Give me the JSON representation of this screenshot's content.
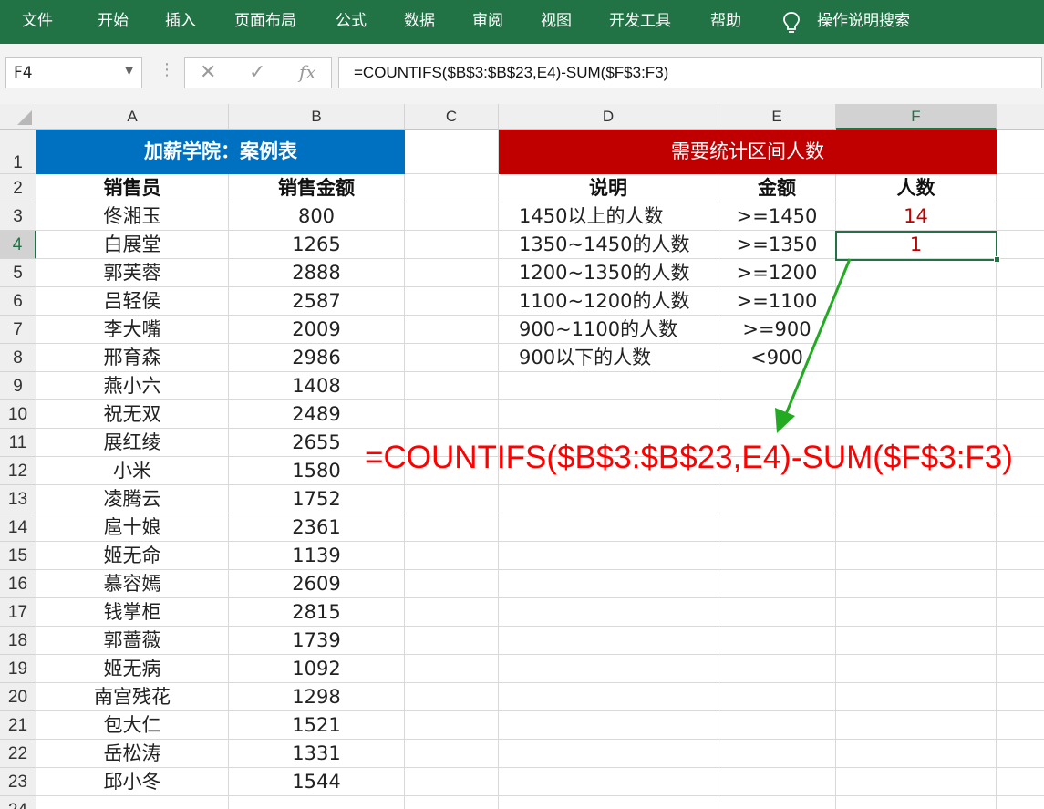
{
  "ribbon": {
    "tabs": [
      "文件",
      "开始",
      "插入",
      "页面布局",
      "公式",
      "数据",
      "审阅",
      "视图",
      "开发工具",
      "帮助"
    ],
    "search_label": "操作说明搜索"
  },
  "formula_bar": {
    "name_box": "F4",
    "fx_label": "fx",
    "cancel_icon": "✕",
    "enter_icon": "✓",
    "formula": "=COUNTIFS($B$3:$B$23,E4)-SUM($F$3:F3)"
  },
  "grid": {
    "columns": [
      "A",
      "B",
      "C",
      "D",
      "E",
      "F"
    ],
    "selected_cell": "F4",
    "row_numbers": [
      "1",
      "2",
      "3",
      "4",
      "5",
      "6",
      "7",
      "8",
      "9",
      "10",
      "11",
      "12",
      "13",
      "14",
      "15",
      "16",
      "17",
      "18",
      "19",
      "20",
      "21",
      "22",
      "23",
      "24"
    ]
  },
  "sales_table": {
    "title": "加薪学院：案例表",
    "headers": [
      "销售员",
      "销售金额"
    ],
    "rows": [
      [
        "佟湘玉",
        "800"
      ],
      [
        "白展堂",
        "1265"
      ],
      [
        "郭芙蓉",
        "2888"
      ],
      [
        "吕轻侯",
        "2587"
      ],
      [
        "李大嘴",
        "2009"
      ],
      [
        "邢育森",
        "2986"
      ],
      [
        "燕小六",
        "1408"
      ],
      [
        "祝无双",
        "2489"
      ],
      [
        "展红绫",
        "2655"
      ],
      [
        "小米",
        "1580"
      ],
      [
        "凌腾云",
        "1752"
      ],
      [
        "扈十娘",
        "2361"
      ],
      [
        "姬无命",
        "1139"
      ],
      [
        "慕容嫣",
        "2609"
      ],
      [
        "钱掌柜",
        "2815"
      ],
      [
        "郭蔷薇",
        "1739"
      ],
      [
        "姬无病",
        "1092"
      ],
      [
        "南宫残花",
        "1298"
      ],
      [
        "包大仁",
        "1521"
      ],
      [
        "岳松涛",
        "1331"
      ],
      [
        "邱小冬",
        "1544"
      ]
    ]
  },
  "count_table": {
    "title": "需要统计区间人数",
    "headers": [
      "说明",
      "金额",
      "人数"
    ],
    "rows": [
      [
        "1450以上的人数",
        ">=1450",
        "14"
      ],
      [
        "1350~1450的人数",
        ">=1350",
        "1"
      ],
      [
        "1200~1350的人数",
        ">=1200",
        ""
      ],
      [
        "1100~1200的人数",
        ">=1100",
        ""
      ],
      [
        "900~1100的人数",
        ">=900",
        ""
      ],
      [
        "900以下的人数",
        "<900",
        ""
      ]
    ]
  },
  "annotation": {
    "formula": "=COUNTIFS($B$3:$B$23,E4)-SUM($F$3:F3)",
    "arrow_color": "#22aa22",
    "text_color": "#ff0000"
  },
  "colors": {
    "ribbon": "#217346",
    "title_blue": "#0070c0",
    "title_red": "#c00000",
    "value_red": "#c00000"
  }
}
